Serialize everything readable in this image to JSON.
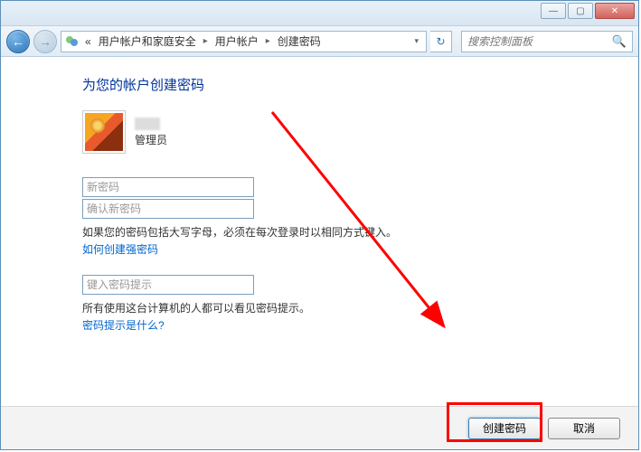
{
  "titlebar": {
    "minimize": "—",
    "maximize": "▢",
    "close": "✕"
  },
  "nav": {
    "back": "←",
    "forward": "→",
    "refresh": "↻",
    "breadcrumb_prefix": "«",
    "crumb1": "用户帐户和家庭安全",
    "crumb2": "用户帐户",
    "crumb3": "创建密码",
    "chevron": "▸",
    "dropdown": "▾",
    "search_placeholder": "搜索控制面板",
    "search_icon": "🔍"
  },
  "page": {
    "title": "为您的帐户创建密码",
    "user_role": "管理员",
    "new_password_placeholder": "新密码",
    "confirm_password_placeholder": "确认新密码",
    "caps_hint": "如果您的密码包括大写字母，必须在每次登录时以相同方式键入。",
    "strong_link": "如何创建强密码",
    "hint_placeholder": "键入密码提示",
    "hint_visible_text": "所有使用这台计算机的人都可以看见密码提示。",
    "hint_link": "密码提示是什么?"
  },
  "footer": {
    "create": "创建密码",
    "cancel": "取消"
  }
}
